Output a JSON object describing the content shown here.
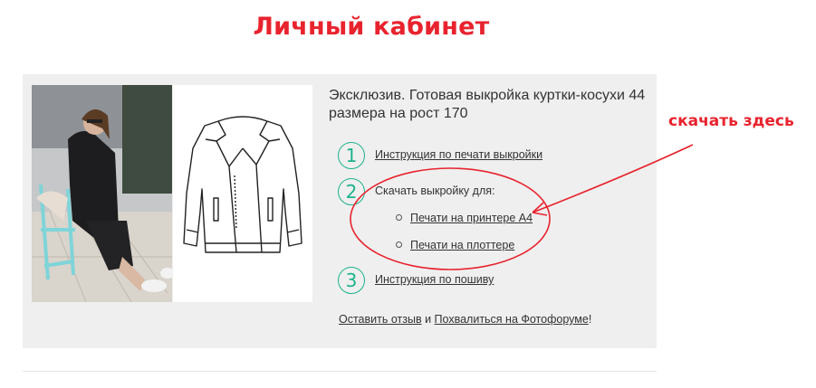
{
  "page": {
    "title": "Личный кабинет"
  },
  "product": {
    "title": "Эксклюзив. Готовая выкройка куртки-косухи 44 размера на рост 170",
    "steps": [
      {
        "num": "1",
        "label": "Инструкция по печати выкройки"
      },
      {
        "num": "2",
        "label": "Скачать выкройку для:",
        "options": [
          "Печати на принтере А4",
          "Печати на плоттере"
        ]
      },
      {
        "num": "3",
        "label": "Инструкция по пошиву"
      }
    ],
    "footer": {
      "review_link": "Оставить отзыв",
      "conjunction": " и ",
      "forum_link": "Похвалиться на Фотофоруме",
      "end": "!"
    }
  },
  "annotation": {
    "label": "скачать здесь",
    "color": "#e8232e"
  },
  "colors": {
    "accent": "#1db28c",
    "title_red": "#e8232e",
    "card_bg": "#efefef"
  }
}
